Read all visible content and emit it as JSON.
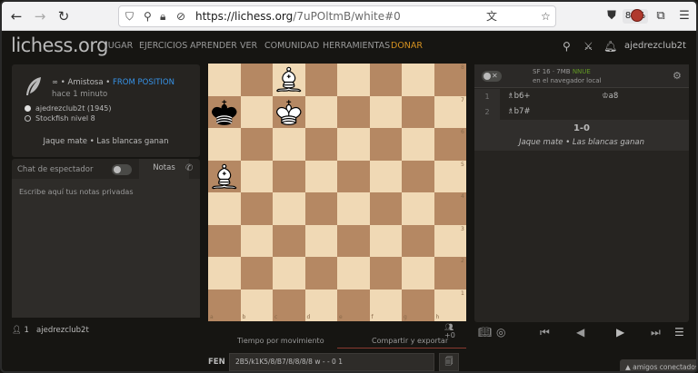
{
  "browser": {
    "url_domain": "https://lichess.org",
    "url_path": "/7uPOltmB/white#0",
    "zoom": "80%"
  },
  "header": {
    "logo": "lichess.org",
    "menu": [
      "JUGAR",
      "EJERCICIOS",
      "APRENDER",
      "VER",
      "COMUNIDAD",
      "HERRAMIENTAS"
    ],
    "donate": "DONAR",
    "username": "ajedrezclub2t"
  },
  "game_info": {
    "type_prefix": "∞ • Amistosa •",
    "from_position": "FROM POSITION",
    "time": "hace 1 minuto",
    "white_player": "ajedrezclub2t (1945)",
    "black_player": "Stockfish nivel 8",
    "result_text": "Jaque mate • Las blancas ganan"
  },
  "chat": {
    "spectator_label": "Chat de espectador",
    "notes_tab": "Notas",
    "notes_placeholder": "Escribe aquí tus notas privadas"
  },
  "watchers": {
    "count": "1",
    "user": "ajedrezclub2t"
  },
  "board": {
    "files": [
      "a",
      "b",
      "c",
      "d",
      "e",
      "f",
      "g",
      "h"
    ],
    "ranks": [
      "8",
      "7",
      "6",
      "5",
      "4",
      "3",
      "2",
      "1"
    ],
    "pieces": [
      {
        "square": "c8",
        "piece": "white-bishop"
      },
      {
        "square": "a7",
        "piece": "black-king"
      },
      {
        "square": "c7",
        "piece": "white-king"
      },
      {
        "square": "a5",
        "piece": "white-bishop"
      }
    ],
    "spectators": "+0"
  },
  "bottom_tabs": {
    "tab1": "Tiempo por movimiento",
    "tab2": "Compartir y exportar"
  },
  "fen": {
    "label": "FEN",
    "value": "2B5/k1K5/8/B7/8/8/8/8 w - - 0 1"
  },
  "analysis": {
    "engine_name": "SF 16 · 7MB",
    "engine_tag": "NNUE",
    "engine_sub": "en el navegador local",
    "moves": [
      {
        "num": "1",
        "white": "♗b6+",
        "black": "♔a8"
      },
      {
        "num": "2",
        "white": "♗b7#",
        "black": ""
      }
    ],
    "score": "1-0",
    "status": "Jaque mate • Las blancas ganan"
  },
  "friends": "amigos conectados"
}
